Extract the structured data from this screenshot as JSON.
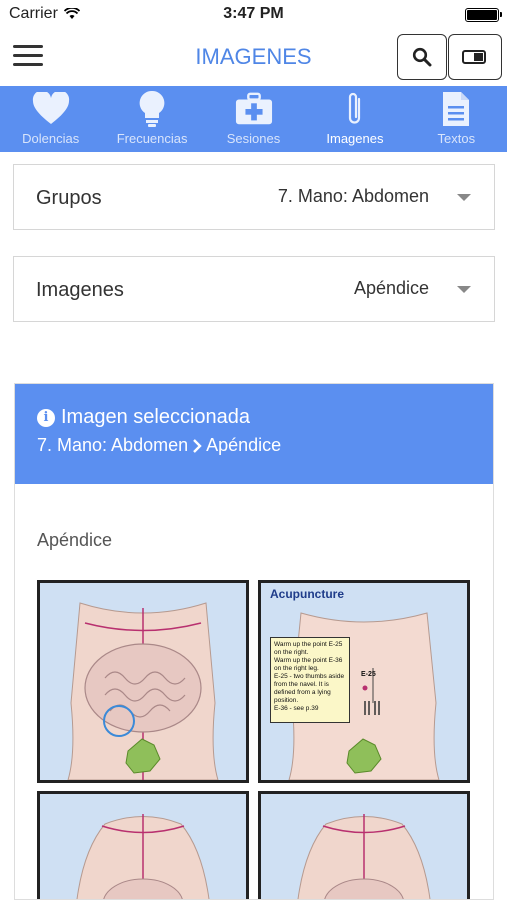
{
  "status_bar": {
    "carrier": "Carrier",
    "time": "3:47 PM"
  },
  "nav": {
    "title": "IMAGENES"
  },
  "tabs": [
    {
      "label": "Dolencias",
      "icon": "heart-icon"
    },
    {
      "label": "Frecuencias",
      "icon": "lightbulb-icon"
    },
    {
      "label": "Sesiones",
      "icon": "medkit-icon"
    },
    {
      "label": "Imagenes",
      "icon": "paperclip-icon"
    },
    {
      "label": "Textos",
      "icon": "document-icon"
    }
  ],
  "grupos": {
    "label": "Grupos",
    "value": "7. Mano: Abdomen"
  },
  "imagenes": {
    "label": "Imagenes",
    "value": "Apéndice"
  },
  "selected": {
    "title": "Imagen seleccionada",
    "crumb_group": "7. Mano: Abdomen",
    "crumb_image": "Apéndice",
    "image_name": "Apéndice"
  },
  "acupuncture": {
    "title": "Acupuncture",
    "note_lines": [
      "Warm up the point E-25 on the right.",
      "Warm up the point E-36 on the right leg.",
      "E-25 - two thumbs aside from the navel. It is defined from a lying position.",
      "E-36 - see p.39"
    ],
    "point_label": "E-25"
  },
  "colors": {
    "accent": "#5b8ff0",
    "title_blue": "#4f86e6"
  }
}
